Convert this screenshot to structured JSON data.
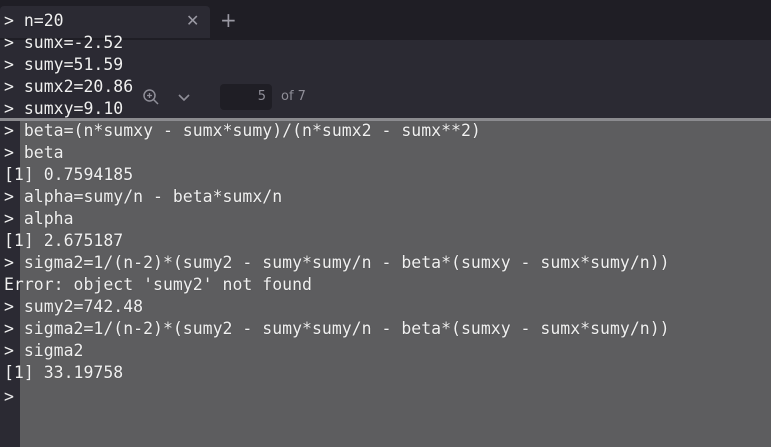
{
  "background_app": {
    "tab_close_glyph": "✕",
    "new_tab_glyph": "+",
    "zoom_icon": "zoom-in-icon",
    "chevron_icon": "chevron-down-icon",
    "page_number": "5",
    "page_of": "of 7"
  },
  "terminal": {
    "prompt": ">",
    "lines": [
      {
        "kind": "input",
        "text": "> n=20"
      },
      {
        "kind": "input",
        "text": "> sumx=-2.52"
      },
      {
        "kind": "input",
        "text": "> sumy=51.59"
      },
      {
        "kind": "input",
        "text": "> sumx2=20.86"
      },
      {
        "kind": "input",
        "text": "> sumxy=9.10"
      },
      {
        "kind": "input",
        "text": "> beta=(n*sumxy - sumx*sumy)/(n*sumx2 - sumx**2)"
      },
      {
        "kind": "input",
        "text": "> beta"
      },
      {
        "kind": "output",
        "text": "[1] 0.7594185"
      },
      {
        "kind": "input",
        "text": "> alpha=sumy/n - beta*sumx/n"
      },
      {
        "kind": "input",
        "text": "> alpha"
      },
      {
        "kind": "output",
        "text": "[1] 2.675187"
      },
      {
        "kind": "input",
        "text": "> sigma2=1/(n-2)*(sumy2 - sumy*sumy/n - beta*(sumxy - sumx*sumy/n))"
      },
      {
        "kind": "error",
        "text": "Error: object 'sumy2' not found"
      },
      {
        "kind": "input",
        "text": "> sumy2=742.48"
      },
      {
        "kind": "input",
        "text": "> sigma2=1/(n-2)*(sumy2 - sumy*sumy/n - beta*(sumxy - sumx*sumy/n))"
      },
      {
        "kind": "input",
        "text": "> sigma2"
      },
      {
        "kind": "output",
        "text": "[1] 33.19758"
      }
    ]
  },
  "colors": {
    "chrome_dark": "#2b2a33",
    "tab_strip": "#1f1e25",
    "document_gray": "#5d5d5f",
    "terminal_text": "#f0f0f0"
  }
}
